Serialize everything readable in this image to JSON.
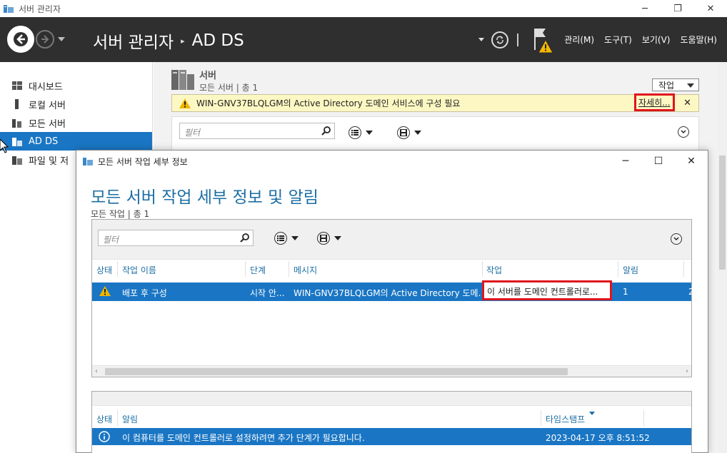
{
  "window": {
    "title": "서버 관리자",
    "controls": [
      "─",
      "❐",
      "✕"
    ]
  },
  "header": {
    "breadcrumb_root": "서버 관리자",
    "breadcrumb_sep": "▸",
    "breadcrumb_current": "AD DS",
    "menu": [
      "관리(M)",
      "도구(T)",
      "보기(V)",
      "도움말(H)"
    ]
  },
  "sidebar": {
    "items": [
      {
        "label": "대시보드",
        "icon": "dashboard-icon"
      },
      {
        "label": "로컬 서버",
        "icon": "local-server-icon"
      },
      {
        "label": "모든 서버",
        "icon": "all-servers-icon"
      },
      {
        "label": "AD DS",
        "icon": "ad-ds-icon",
        "selected": true
      },
      {
        "label": "파일 및 저",
        "icon": "file-storage-icon"
      }
    ]
  },
  "main": {
    "section_title": "서버",
    "section_sub": "모든 서버 | 총 1",
    "task_button": "작업",
    "banner": {
      "message": "WIN-GNV37BLQLGM의 Active Directory 도메인 서비스에 구성 필요",
      "more_link": "자세히...",
      "close": "✕"
    },
    "filter_placeholder": "필터"
  },
  "dialog": {
    "title": "모든 서버 작업 세부 정보",
    "controls": [
      "─",
      "☐",
      "✕"
    ],
    "heading": "모든 서버 작업 세부 정보 및 알림",
    "subheading": "모든 작업 | 총 1",
    "filter_placeholder": "필터",
    "tasks_table": {
      "columns": [
        "상태",
        "작업 이름",
        "단계",
        "메시지",
        "작업",
        "알림"
      ],
      "rows": [
        {
          "status_icon": "warning-icon",
          "name": "배포 후 구성",
          "stage": "시작 안...",
          "message": "WIN-GNV37BLQLGM의 Active Directory 도메...",
          "action": "이 서버를 도메인 컨트롤러로...",
          "notifications": "1",
          "extra": "2"
        }
      ]
    },
    "notifications_table": {
      "columns": [
        "상태",
        "알림",
        "타임스탬프"
      ],
      "rows": [
        {
          "status_icon": "info-icon",
          "message": "이 컴퓨터를 도메인 컨트롤러로 설정하려면 추가 단계가 필요합니다.",
          "timestamp": "2023-04-17 오후 8:51:52"
        }
      ]
    }
  },
  "colors": {
    "header_bg": "#2f2f2f",
    "selected_blue": "#1a76c4",
    "heading_blue": "#1c6ea4",
    "banner_yellow": "#fdf8c3",
    "highlight_red": "#e0141f"
  }
}
